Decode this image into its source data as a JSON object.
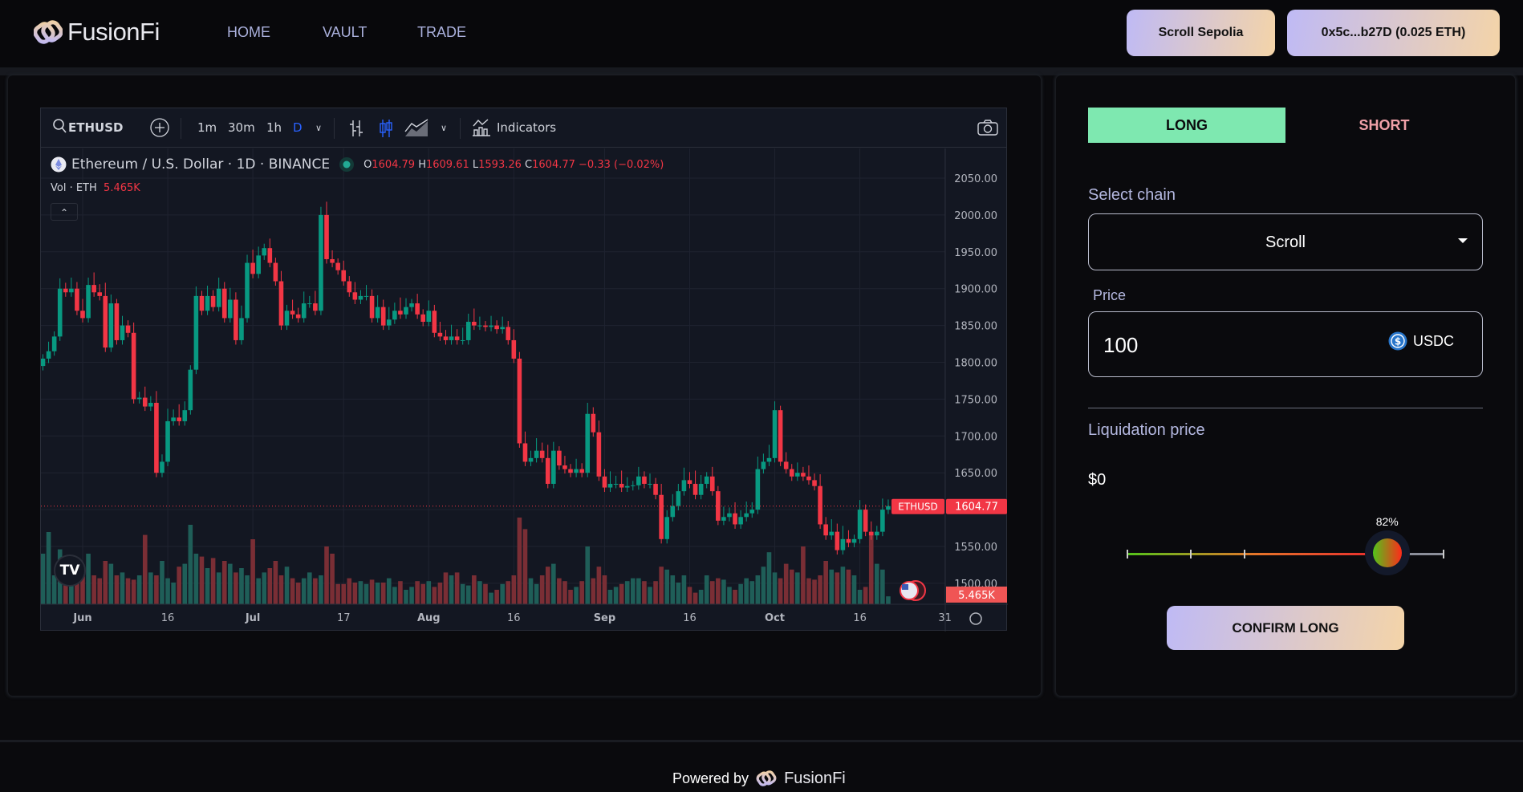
{
  "header": {
    "brand": "FusionFi",
    "nav": [
      "HOME",
      "VAULT",
      "TRADE"
    ],
    "network_button": "Scroll Sepolia",
    "wallet_button": "0x5c...b27D (0.025 ETH)"
  },
  "chart_toolbar": {
    "symbol": "ETHUSD",
    "intervals": [
      "1m",
      "30m",
      "1h",
      "D"
    ],
    "active_interval": "D",
    "indicators": "Indicators"
  },
  "chart_legend": {
    "title": "Ethereum / U.S. Dollar · 1D · BINANCE",
    "o_label": "O",
    "o": "1604.79",
    "h_label": "H",
    "h": "1609.61",
    "l_label": "L",
    "l": "1593.26",
    "c_label": "C",
    "c": "1604.77",
    "change": "−0.33 (−0.02%)",
    "vol_label": "Vol · ETH",
    "vol": "5.465K"
  },
  "chart_data": {
    "type": "candlestick",
    "symbol_label": "ETHUSD",
    "last_price": "1604.77",
    "last_volume": "5.465K",
    "first_candle_date": "May 25",
    "ylim": [
      1480,
      2075
    ],
    "y_ticks": [
      "2050.00",
      "2000.00",
      "1950.00",
      "1900.00",
      "1850.00",
      "1800.00",
      "1750.00",
      "1700.00",
      "1650.00",
      "1600.00",
      "1550.00",
      "1500.00"
    ],
    "x_ticks": [
      {
        "label": "Jun",
        "date": "Jun 1"
      },
      {
        "label": "16",
        "date": "Jun 16"
      },
      {
        "label": "Jul",
        "date": "Jul 1"
      },
      {
        "label": "17",
        "date": "Jul 17"
      },
      {
        "label": "Aug",
        "date": "Aug 1"
      },
      {
        "label": "16",
        "date": "Aug 16"
      },
      {
        "label": "Sep",
        "date": "Sep 1"
      },
      {
        "label": "16",
        "date": "Sep 16"
      },
      {
        "label": "Oct",
        "date": "Oct 1"
      },
      {
        "label": "16",
        "date": "Oct 16"
      },
      {
        "label": "31",
        "date": "Oct 31"
      }
    ],
    "close": [
      1805,
      1815,
      1835,
      1900,
      1895,
      1900,
      1870,
      1860,
      1905,
      1895,
      1890,
      1820,
      1880,
      1830,
      1850,
      1840,
      1750,
      1752,
      1740,
      1745,
      1650,
      1665,
      1720,
      1725,
      1720,
      1735,
      1790,
      1890,
      1870,
      1890,
      1875,
      1900,
      1860,
      1885,
      1830,
      1860,
      1935,
      1920,
      1945,
      1955,
      1935,
      1910,
      1850,
      1870,
      1865,
      1860,
      1880,
      1880,
      1870,
      2000,
      1940,
      1935,
      1925,
      1910,
      1895,
      1885,
      1890,
      1890,
      1860,
      1875,
      1850,
      1858,
      1870,
      1865,
      1875,
      1880,
      1865,
      1855,
      1870,
      1840,
      1835,
      1830,
      1835,
      1830,
      1830,
      1855,
      1850,
      1850,
      1848,
      1850,
      1845,
      1848,
      1830,
      1805,
      1690,
      1665,
      1670,
      1680,
      1670,
      1635,
      1680,
      1660,
      1655,
      1650,
      1655,
      1650,
      1730,
      1705,
      1645,
      1630,
      1635,
      1635,
      1630,
      1632,
      1633,
      1645,
      1635,
      1635,
      1620,
      1560,
      1590,
      1605,
      1625,
      1640,
      1635,
      1620,
      1635,
      1645,
      1625,
      1585,
      1590,
      1595,
      1580,
      1590,
      1595,
      1600,
      1655,
      1665,
      1670,
      1735,
      1665,
      1655,
      1645,
      1650,
      1645,
      1640,
      1632,
      1580,
      1565,
      1570,
      1545,
      1560,
      1555,
      1560,
      1600,
      1570,
      1565,
      1570,
      1600,
      1604.77
    ],
    "volume_k": [
      35,
      50,
      20,
      38,
      28,
      20,
      18,
      22,
      35,
      20,
      18,
      30,
      28,
      20,
      22,
      18,
      17,
      20,
      48,
      22,
      20,
      30,
      18,
      15,
      26,
      28,
      55,
      35,
      33,
      25,
      32,
      22,
      30,
      28,
      22,
      25,
      20,
      45,
      18,
      22,
      25,
      30,
      20,
      26,
      18,
      15,
      18,
      22,
      18,
      20,
      40,
      35,
      14,
      14,
      18,
      15,
      16,
      14,
      17,
      15,
      15,
      18,
      12,
      16,
      10,
      12,
      16,
      14,
      16,
      12,
      15,
      22,
      20,
      22,
      14,
      13,
      20,
      16,
      14,
      8,
      10,
      14,
      16,
      20,
      60,
      52,
      18,
      14,
      20,
      26,
      28,
      18,
      16,
      10,
      12,
      16,
      40,
      18,
      26,
      20,
      10,
      12,
      14,
      16,
      18,
      18,
      16,
      12,
      16,
      26,
      24,
      20,
      15,
      20,
      12,
      8,
      10,
      20,
      16,
      18,
      17,
      12,
      10,
      14,
      18,
      16,
      20,
      26,
      36,
      22,
      18,
      28,
      24,
      22,
      40,
      18,
      17,
      20,
      30,
      24,
      22,
      26,
      24,
      20,
      10,
      12,
      50,
      28,
      24,
      5.465
    ],
    "colors": {
      "up": "#089981",
      "down": "#f23645",
      "up_volume": "#1f5e58",
      "down_volume": "#7a2e35",
      "background": "#131722"
    }
  },
  "trade": {
    "tabs": [
      "LONG",
      "SHORT"
    ],
    "active_tab": "LONG",
    "select_chain_label": "Select chain",
    "chain_value": "Scroll",
    "price_label": "Price",
    "price_value": "100",
    "currency": "USDC",
    "liquidation_label": "Liquidation price",
    "liquidation_value": "$0",
    "leverage_percent_label": "82%",
    "leverage_percent": 82,
    "confirm": "CONFIRM LONG",
    "colors": {
      "long": "#7ee8b0",
      "short": "#f0a0a8"
    }
  },
  "footer": {
    "powered_by": "Powered by",
    "brand": "FusionFi"
  }
}
